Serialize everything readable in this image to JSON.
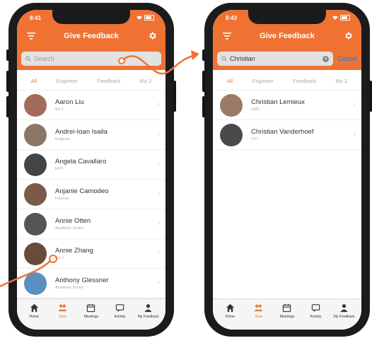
{
  "screens": {
    "left": {
      "time": "8:41",
      "title": "Give Feedback",
      "search": {
        "placeholder": "Search",
        "value": ""
      },
      "tabs": [
        {
          "label": "All",
          "active": true
        },
        {
          "label": "Engineer",
          "active": false
        },
        {
          "label": "Feedback",
          "active": false
        },
        {
          "label": "Biz 2",
          "active": false
        }
      ],
      "people": [
        {
          "name": "Aaron Liu",
          "sub": "Biz 1",
          "color": "#a36b5a"
        },
        {
          "name": "Andrei-Ioan Isaila",
          "sub": "Engineer",
          "color": "#8b7668"
        },
        {
          "name": "Angela Cavallaro",
          "sub": "EPP",
          "color": "#444444"
        },
        {
          "name": "Anjanie Camodeo",
          "sub": "Finance",
          "color": "#7b5a48"
        },
        {
          "name": "Annie Otten",
          "sub": "Academy Sinder",
          "color": "#555555"
        },
        {
          "name": "Annie Zhang",
          "sub": "Biz 2",
          "color": "#6a4a3a"
        },
        {
          "name": "Anthony Glessner",
          "sub": "Academy Sinder",
          "color": "#5a8fc0"
        }
      ]
    },
    "right": {
      "time": "8:43",
      "title": "Give Feedback",
      "search": {
        "placeholder": "Search",
        "value": "Christian"
      },
      "cancel_label": "Cancel",
      "tabs": [
        {
          "label": "All",
          "active": true
        },
        {
          "label": "Engineer",
          "active": false
        },
        {
          "label": "Feedback",
          "active": false
        },
        {
          "label": "Biz 2",
          "active": false
        }
      ],
      "people": [
        {
          "name": "Christian Lemieux",
          "sub": "EMS",
          "color": "#9a7a68"
        },
        {
          "name": "Christian Vanderhoef",
          "sub": "CFT",
          "color": "#4a4a4a"
        }
      ]
    }
  },
  "tabbar": [
    {
      "label": "Home",
      "icon": "home-icon"
    },
    {
      "label": "Give",
      "icon": "people-icon"
    },
    {
      "label": "Meetings",
      "icon": "calendar-icon"
    },
    {
      "label": "Activity",
      "icon": "chat-icon"
    },
    {
      "label": "My Feedback",
      "icon": "person-icon"
    }
  ],
  "colors": {
    "accent": "#ef7233",
    "link": "#1f7ee0"
  }
}
